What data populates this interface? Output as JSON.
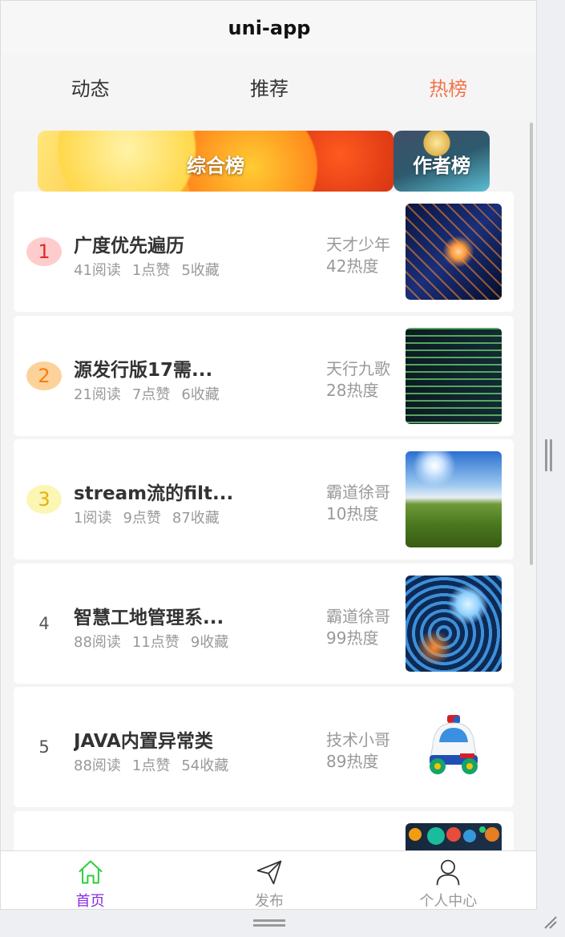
{
  "app": {
    "title": "uni-app"
  },
  "tabs": [
    {
      "label": "动态",
      "active": false
    },
    {
      "label": "推荐",
      "active": false
    },
    {
      "label": "热榜",
      "active": true
    }
  ],
  "accent_color": "#f3744a",
  "banners": [
    {
      "label": "综合榜"
    },
    {
      "label": "作者榜"
    }
  ],
  "articles": [
    {
      "rank": "1",
      "title": "广度优先遍历",
      "reads": "41阅读",
      "likes": "1点赞",
      "favs": "5收藏",
      "author": "天才少年",
      "heat": "42热度",
      "thumb": "circuit-chip-image"
    },
    {
      "rank": "2",
      "title": "源发行版17需...",
      "reads": "21阅读",
      "likes": "7点赞",
      "favs": "6收藏",
      "author": "天行九歌",
      "heat": "28热度",
      "thumb": "code-screen-image"
    },
    {
      "rank": "3",
      "title": "stream流的filt...",
      "reads": "1阅读",
      "likes": "9点赞",
      "favs": "87收藏",
      "author": "霸道徐哥",
      "heat": "10热度",
      "thumb": "landscape-image"
    },
    {
      "rank": "4",
      "title": "智慧工地管理系...",
      "reads": "88阅读",
      "likes": "11点赞",
      "favs": "9收藏",
      "author": "霸道徐哥",
      "heat": "99热度",
      "thumb": "tech-globe-image"
    },
    {
      "rank": "5",
      "title": "JAVA内置异常类",
      "reads": "88阅读",
      "likes": "1点赞",
      "favs": "54收藏",
      "author": "技术小哥",
      "heat": "89热度",
      "thumb": "toy-car-image"
    }
  ],
  "nav": [
    {
      "label": "首页",
      "icon": "home-icon",
      "active": true
    },
    {
      "label": "发布",
      "icon": "send-icon",
      "active": false
    },
    {
      "label": "个人中心",
      "icon": "user-icon",
      "active": false
    }
  ]
}
